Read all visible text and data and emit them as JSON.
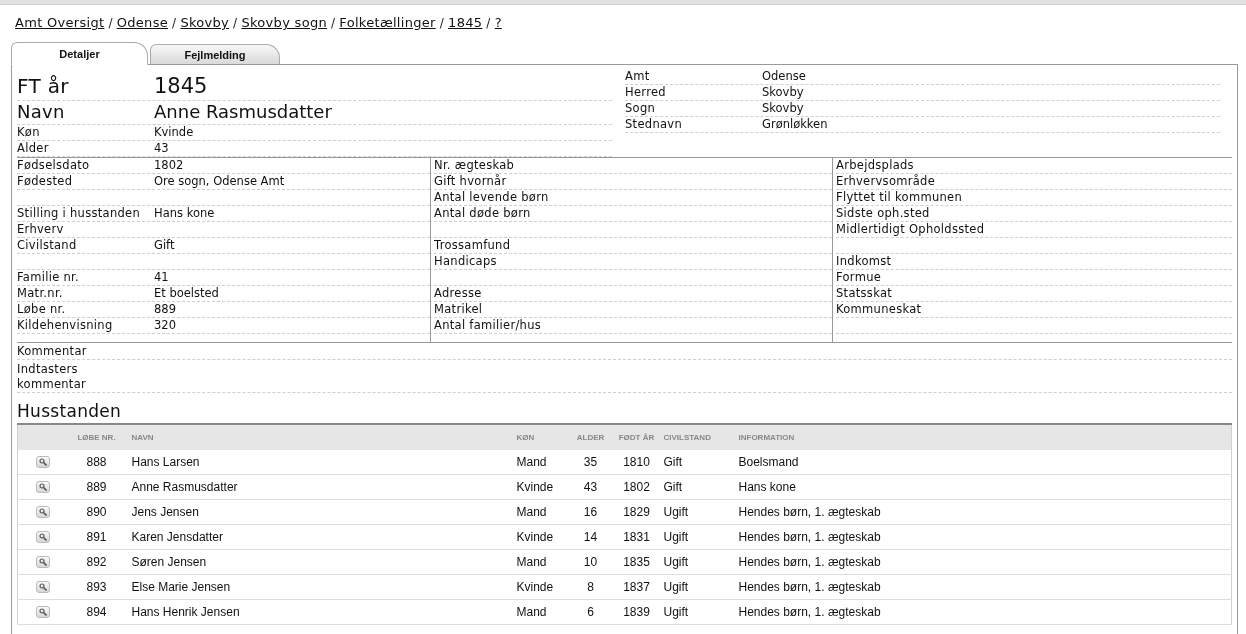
{
  "breadcrumb": {
    "separator": "/",
    "items": [
      "Amt Oversigt",
      "Odense",
      "Skovby",
      "Skovby sogn",
      "Folketællinger",
      "1845",
      "?"
    ]
  },
  "tabs": [
    {
      "label": "Detaljer",
      "selected": true
    },
    {
      "label": "Fejlmelding",
      "selected": false
    }
  ],
  "summary": {
    "census_year": {
      "label": "FT år",
      "value": "1845"
    },
    "name": {
      "label": "Navn",
      "value": "Anne Rasmusdatter"
    },
    "fields": [
      {
        "label": "Køn",
        "value": "Kvinde"
      },
      {
        "label": "Alder",
        "value": "43"
      }
    ]
  },
  "location": [
    {
      "label": "Amt",
      "value": "Odense"
    },
    {
      "label": "Herred",
      "value": "Skovby"
    },
    {
      "label": "Sogn",
      "value": "Skovby"
    },
    {
      "label": "Stednavn",
      "value": "Grønløkken"
    }
  ],
  "details_columns": [
    [
      {
        "kind": "field",
        "label": "Fødselsdato",
        "value": "1802"
      },
      {
        "kind": "field",
        "label": "Fødested",
        "value": "Ore sogn, Odense Amt"
      },
      {
        "kind": "spacer"
      },
      {
        "kind": "field",
        "label": "Stilling i husstanden",
        "value": "Hans kone"
      },
      {
        "kind": "field",
        "label": "Erhverv"
      },
      {
        "kind": "field",
        "label": "Civilstand",
        "value": "Gift"
      },
      {
        "kind": "spacer"
      },
      {
        "kind": "field",
        "label": "Familie nr.",
        "value": "41"
      },
      {
        "kind": "field",
        "label": "Matr.nr.",
        "value": "Et boelsted"
      },
      {
        "kind": "field",
        "label": "Løbe nr.",
        "value": "889"
      },
      {
        "kind": "field",
        "label": "Kildehenvisning",
        "value": "320"
      }
    ],
    [
      {
        "kind": "field",
        "label": "Nr. ægteskab"
      },
      {
        "kind": "field",
        "label": "Gift hvornår"
      },
      {
        "kind": "field",
        "label": "Antal levende børn"
      },
      {
        "kind": "field",
        "label": "Antal døde børn"
      },
      {
        "kind": "spacer"
      },
      {
        "kind": "field",
        "label": "Trossamfund"
      },
      {
        "kind": "field",
        "label": "Handicaps"
      },
      {
        "kind": "spacer"
      },
      {
        "kind": "field",
        "label": "Adresse"
      },
      {
        "kind": "field",
        "label": "Matrikel"
      },
      {
        "kind": "field",
        "label": "Antal familier/hus"
      }
    ],
    [
      {
        "kind": "field",
        "label": "Arbejdsplads"
      },
      {
        "kind": "field",
        "label": "Erhvervsområde"
      },
      {
        "kind": "field",
        "label": "Flyttet til kommunen"
      },
      {
        "kind": "field",
        "label": "Sidste oph.sted"
      },
      {
        "kind": "field",
        "label": "Midlertidigt Opholdssted"
      },
      {
        "kind": "spacer"
      },
      {
        "kind": "field",
        "label": "Indkomst"
      },
      {
        "kind": "field",
        "label": "Formue"
      },
      {
        "kind": "field",
        "label": "Statsskat"
      },
      {
        "kind": "field",
        "label": "Kommuneskat"
      },
      {
        "kind": "spacer"
      }
    ]
  ],
  "comments": [
    {
      "label": "Kommentar"
    },
    {
      "label": "Indtasters kommentar"
    }
  ],
  "household": {
    "title": "Husstanden",
    "columns": [
      "LØBE NR.",
      "NAVN",
      "KØN",
      "ALDER",
      "FØDT ÅR",
      "CIVILSTAND",
      "INFORMATION"
    ],
    "rows": [
      [
        "888",
        "Hans Larsen",
        "Mand",
        "35",
        "1810",
        "Gift",
        "Boelsmand"
      ],
      [
        "889",
        "Anne Rasmusdatter",
        "Kvinde",
        "43",
        "1802",
        "Gift",
        "Hans kone"
      ],
      [
        "890",
        "Jens Jensen",
        "Mand",
        "16",
        "1829",
        "Ugift",
        "Hendes børn, 1. ægteskab"
      ],
      [
        "891",
        "Karen Jensdatter",
        "Kvinde",
        "14",
        "1831",
        "Ugift",
        "Hendes børn, 1. ægteskab"
      ],
      [
        "892",
        "Søren Jensen",
        "Mand",
        "10",
        "1835",
        "Ugift",
        "Hendes børn, 1. ægteskab"
      ],
      [
        "893",
        "Else Marie Jensen",
        "Kvinde",
        "8",
        "1837",
        "Ugift",
        "Hendes børn, 1. ægteskab"
      ],
      [
        "894",
        "Hans Henrik Jensen",
        "Mand",
        "6",
        "1839",
        "Ugift",
        "Hendes børn, 1. ægteskab"
      ]
    ]
  }
}
